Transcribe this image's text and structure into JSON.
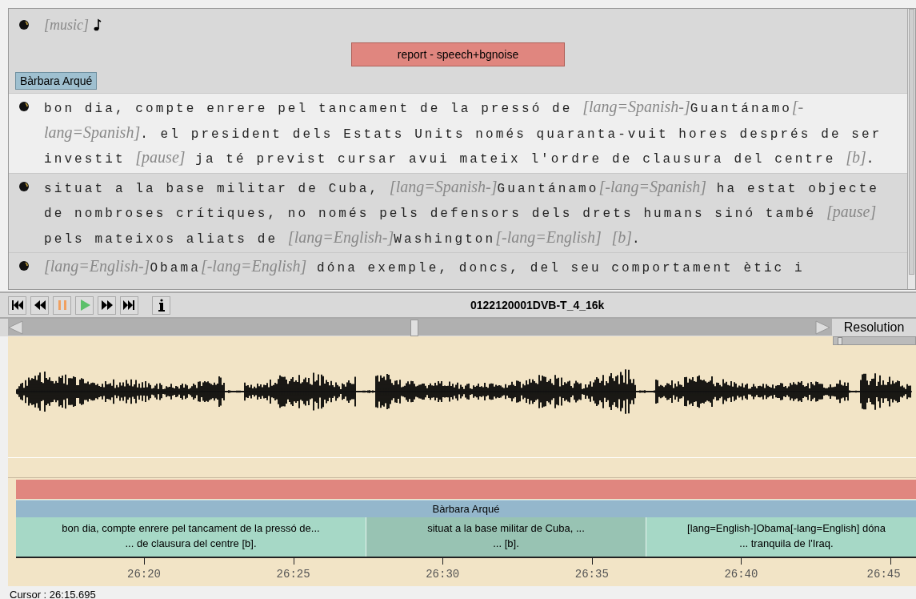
{
  "transcript": {
    "items": [
      {
        "kind": "event",
        "text": "[music]"
      },
      {
        "kind": "section",
        "label": "report - speech+bgnoise"
      },
      {
        "kind": "speaker",
        "label": "Bàrbara Arqué"
      },
      {
        "kind": "segment",
        "selected": true,
        "text": "bon dia, compte enrere pel tancament de la pressó de [lang=Spanish-]Guantánamo[-lang=Spanish]. el president dels Estats Units només quaranta-vuit hores després de ser investit [pause] ja té previst cursar avui mateix l'ordre de clausura del centre [b]."
      },
      {
        "kind": "segment",
        "selected": false,
        "text": "situat a la base militar de Cuba, [lang=Spanish-]Guantánamo[-lang=Spanish] ha estat objecte de nombroses crítiques, no només pels defensors dels drets humans sinó també [pause] pels mateixos aliats de [lang=English-]Washington[-lang=English] [b]."
      },
      {
        "kind": "segment",
        "selected": false,
        "text": "[lang=English-]Obama[-lang=English] dóna exemple, doncs, del seu comportament ètic i"
      }
    ]
  },
  "player": {
    "buttons": [
      {
        "kind": "start"
      },
      {
        "kind": "rewind"
      },
      {
        "kind": "pause"
      },
      {
        "kind": "play"
      },
      {
        "kind": "forward"
      },
      {
        "kind": "end"
      },
      {
        "kind": "info"
      }
    ],
    "file": "0122120001DVB-T_4_16k"
  },
  "zoom": {
    "label": "Resolution",
    "level": 0.05
  },
  "timeline": {
    "speaker": "Bàrbara Arqué",
    "segments": [
      {
        "selected": false,
        "lines": [
          "bon dia, compte enrere pel tancament de la pressó de...",
          "... de clausura del centre [b]."
        ]
      },
      {
        "selected": true,
        "lines": [
          "situat a la base militar de Cuba, ...",
          "... [b]."
        ]
      },
      {
        "selected": false,
        "lines": [
          "[lang=English-]Obama[-lang=English] dóna",
          "... tranquila de l'Iraq."
        ]
      }
    ],
    "ticks": [
      "26:20",
      "26:25",
      "26:30",
      "26:35",
      "26:40",
      "26:45"
    ]
  },
  "status": {
    "cursor": "Cursor : 26:15.695"
  }
}
